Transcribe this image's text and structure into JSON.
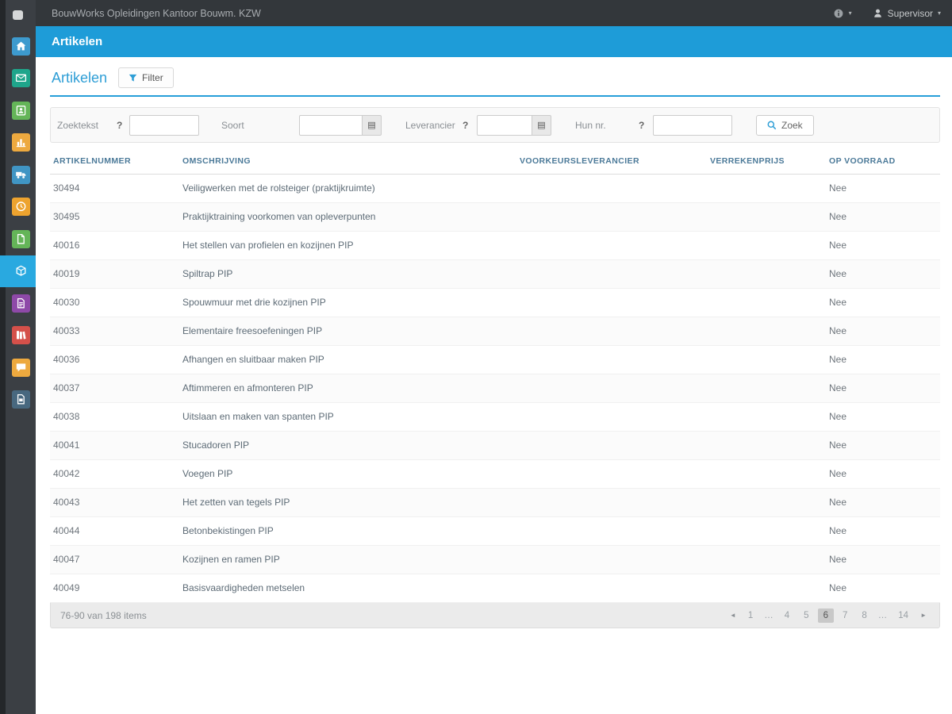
{
  "topbar": {
    "title": "BouwWorks Opleidingen Kantoor Bouwm. KZW",
    "user_label": "Supervisor"
  },
  "glyphs": {
    "caret_down": "▾",
    "pager_prev": "◄",
    "pager_next": "►",
    "lookup_icon": "▤",
    "help": "?"
  },
  "page_header": {
    "title": "Artikelen"
  },
  "content": {
    "title": "Artikelen",
    "filter_button": "Filter"
  },
  "filter_panel": {
    "zoektekst_label": "Zoektekst",
    "zoektekst_value": "",
    "soort_label": "Soort",
    "soort_value": "",
    "leverancier_label": "Leverancier",
    "leverancier_value": "",
    "hunnr_label": "Hun nr.",
    "hunnr_value": "",
    "search_button": "Zoek"
  },
  "table": {
    "columns": [
      "Artikelnummer",
      "Omschrijving",
      "Voorkeursleverancier",
      "Verrekenprijs",
      "Op voorraad"
    ],
    "rows": [
      {
        "artikelnummer": "30494",
        "omschrijving": "Veiligwerken met de rolsteiger (praktijkruimte)",
        "voorkeursleverancier": "",
        "verrekenprijs": "",
        "op_voorraad": "Nee"
      },
      {
        "artikelnummer": "30495",
        "omschrijving": "Praktijktraining voorkomen van opleverpunten",
        "voorkeursleverancier": "",
        "verrekenprijs": "",
        "op_voorraad": "Nee"
      },
      {
        "artikelnummer": "40016",
        "omschrijving": "Het stellen van profielen en kozijnen PIP",
        "voorkeursleverancier": "",
        "verrekenprijs": "",
        "op_voorraad": "Nee"
      },
      {
        "artikelnummer": "40019",
        "omschrijving": "Spiltrap PIP",
        "voorkeursleverancier": "",
        "verrekenprijs": "",
        "op_voorraad": "Nee"
      },
      {
        "artikelnummer": "40030",
        "omschrijving": "Spouwmuur met drie kozijnen PIP",
        "voorkeursleverancier": "",
        "verrekenprijs": "",
        "op_voorraad": "Nee"
      },
      {
        "artikelnummer": "40033",
        "omschrijving": "Elementaire freesoefeningen PIP",
        "voorkeursleverancier": "",
        "verrekenprijs": "",
        "op_voorraad": "Nee"
      },
      {
        "artikelnummer": "40036",
        "omschrijving": "Afhangen en sluitbaar maken PIP",
        "voorkeursleverancier": "",
        "verrekenprijs": "",
        "op_voorraad": "Nee"
      },
      {
        "artikelnummer": "40037",
        "omschrijving": "Aftimmeren en afmonteren PIP",
        "voorkeursleverancier": "",
        "verrekenprijs": "",
        "op_voorraad": "Nee"
      },
      {
        "artikelnummer": "40038",
        "omschrijving": "Uitslaan en maken van spanten PIP",
        "voorkeursleverancier": "",
        "verrekenprijs": "",
        "op_voorraad": "Nee"
      },
      {
        "artikelnummer": "40041",
        "omschrijving": "Stucadoren PIP",
        "voorkeursleverancier": "",
        "verrekenprijs": "",
        "op_voorraad": "Nee"
      },
      {
        "artikelnummer": "40042",
        "omschrijving": "Voegen PIP",
        "voorkeursleverancier": "",
        "verrekenprijs": "",
        "op_voorraad": "Nee"
      },
      {
        "artikelnummer": "40043",
        "omschrijving": "Het zetten van tegels PIP",
        "voorkeursleverancier": "",
        "verrekenprijs": "",
        "op_voorraad": "Nee"
      },
      {
        "artikelnummer": "40044",
        "omschrijving": "Betonbekistingen PIP",
        "voorkeursleverancier": "",
        "verrekenprijs": "",
        "op_voorraad": "Nee"
      },
      {
        "artikelnummer": "40047",
        "omschrijving": "Kozijnen en ramen PIP",
        "voorkeursleverancier": "",
        "verrekenprijs": "",
        "op_voorraad": "Nee"
      },
      {
        "artikelnummer": "40049",
        "omschrijving": "Basisvaardigheden metselen",
        "voorkeursleverancier": "",
        "verrekenprijs": "",
        "op_voorraad": "Nee"
      }
    ]
  },
  "footer": {
    "summary": "76-90 van 198 items",
    "pages": [
      "1",
      "…",
      "4",
      "5",
      "6",
      "7",
      "8",
      "…",
      "14"
    ],
    "active_page": "6"
  },
  "sidebar": {
    "items": [
      {
        "id": "home",
        "icon": "home-icon",
        "color": "#3d9ace",
        "active": false
      },
      {
        "id": "mail",
        "icon": "envelope-icon",
        "color": "#1fa58b",
        "active": false
      },
      {
        "id": "relations",
        "icon": "contact-icon",
        "color": "#64b558",
        "active": false
      },
      {
        "id": "reports",
        "icon": "chart-icon",
        "color": "#eda93f",
        "active": false
      },
      {
        "id": "transport",
        "icon": "truck-icon",
        "color": "#4095c4",
        "active": false
      },
      {
        "id": "planning",
        "icon": "clock-icon",
        "color": "#eda32f",
        "active": false
      },
      {
        "id": "documents",
        "icon": "document-icon",
        "color": "#64b558",
        "active": false
      },
      {
        "id": "artikelen",
        "icon": "package-icon",
        "color": "#29a9e0",
        "active": true
      },
      {
        "id": "forms",
        "icon": "form-icon",
        "color": "#8e49a8",
        "active": false
      },
      {
        "id": "library",
        "icon": "books-icon",
        "color": "#d4504a",
        "active": false
      },
      {
        "id": "messages",
        "icon": "comment-icon",
        "color": "#eda93f",
        "active": false
      },
      {
        "id": "archive",
        "icon": "file-image-icon",
        "color": "#48687f",
        "active": false
      }
    ]
  },
  "colors": {
    "accent_blue": "#1e9cd8",
    "sidebar_active": "#29a9e0",
    "table_header_text": "#4c7a99",
    "topbar_bg": "#33373b",
    "sidebar_bg": "#3b3f44"
  }
}
